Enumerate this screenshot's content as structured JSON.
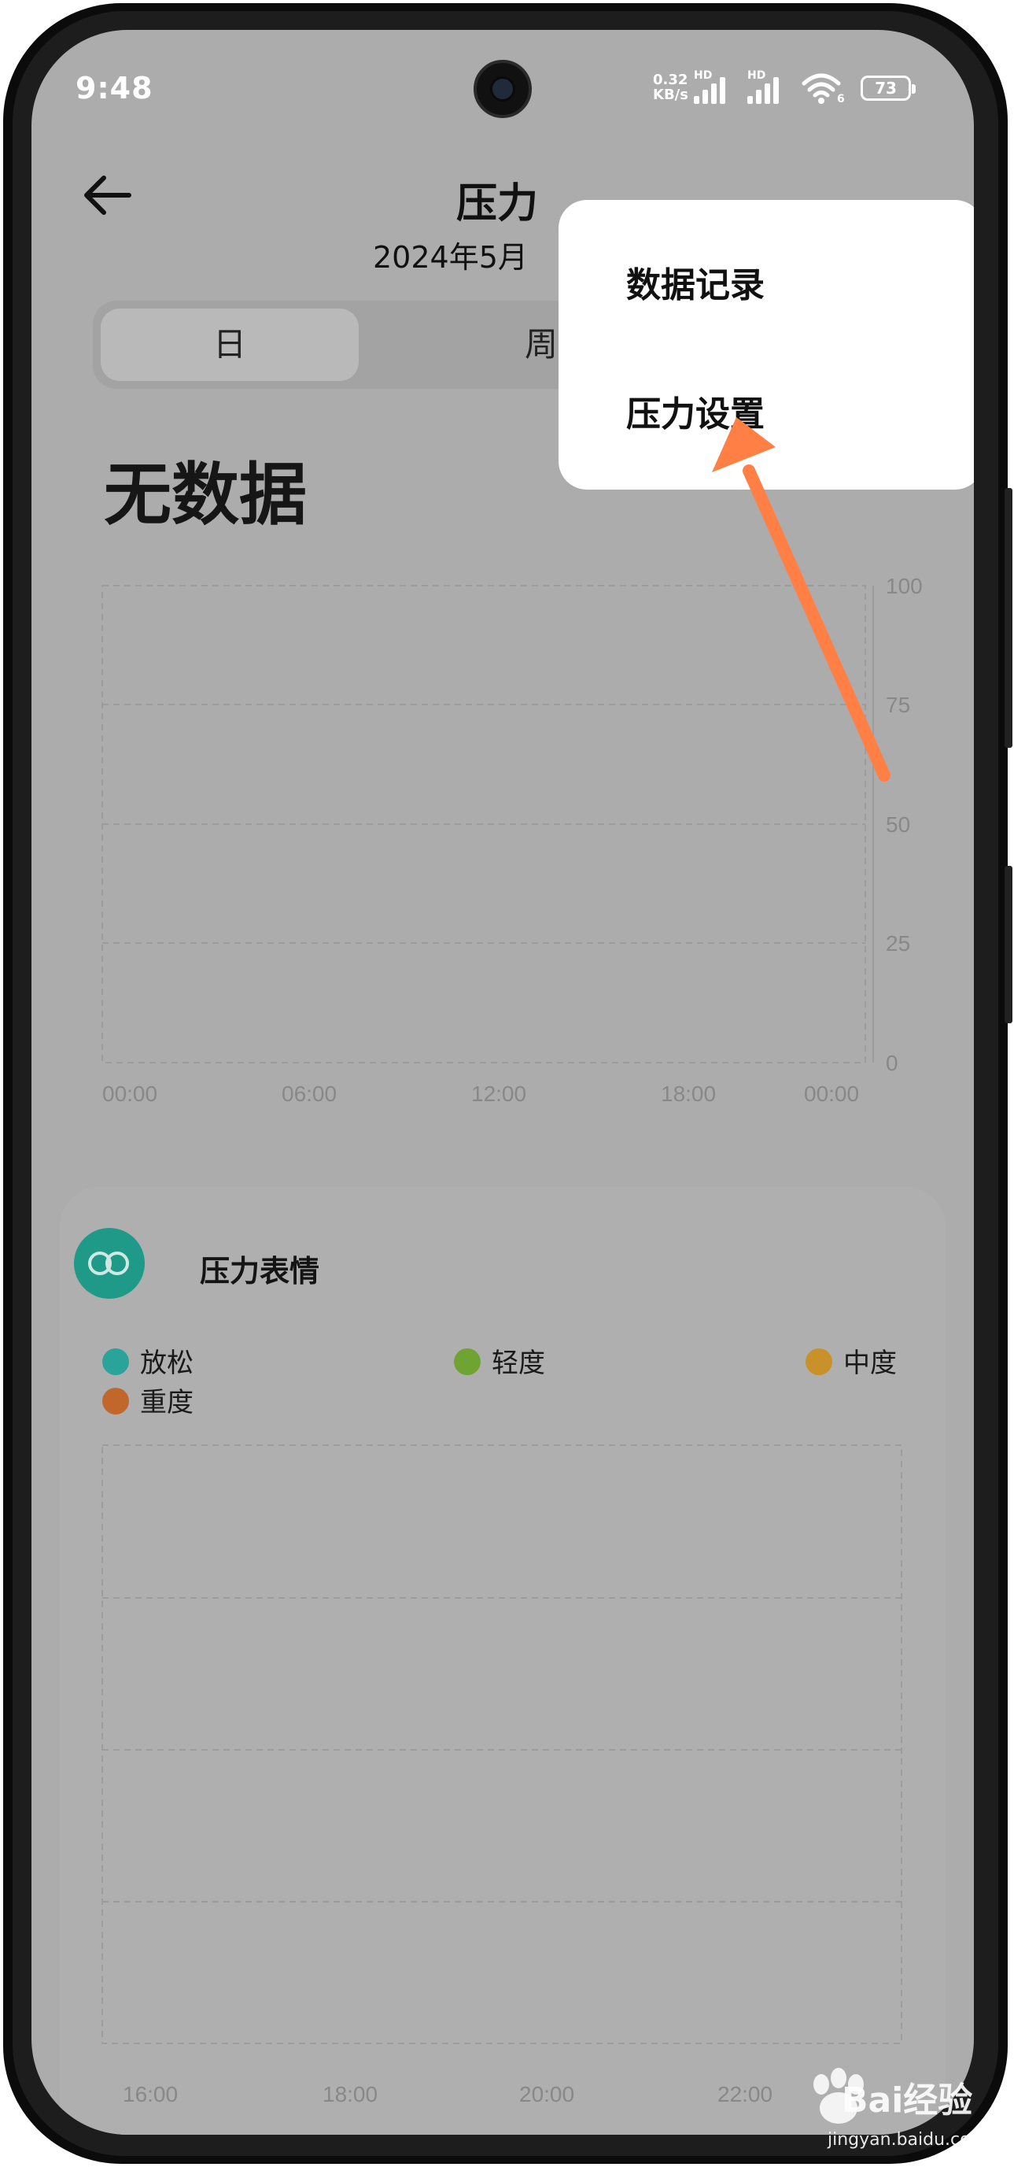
{
  "status_bar": {
    "time": "9:48",
    "net_speed_value": "0.32",
    "net_speed_unit": "KB/s",
    "signal1_label": "HD",
    "signal2_label": "HD",
    "wifi_badge": "6",
    "battery": "73"
  },
  "header": {
    "title": "压力",
    "date": "2024年5月"
  },
  "tabs": {
    "day": "日",
    "week": "周"
  },
  "summary": "无数据",
  "stress_chart": {
    "y_ticks": [
      "100",
      "75",
      "50",
      "25",
      "0"
    ],
    "x_ticks": [
      "00:00",
      "06:00",
      "12:00",
      "18:00",
      "00:00"
    ]
  },
  "chart_data": [
    {
      "type": "bar",
      "title": "",
      "categories": [
        "00:00",
        "06:00",
        "12:00",
        "18:00",
        "00:00"
      ],
      "series": [],
      "ylim": [
        0,
        100
      ],
      "y_ticks": [
        100,
        75,
        50,
        25,
        0
      ],
      "grid": true
    },
    {
      "type": "bar",
      "title": "压力表情",
      "categories": [
        "16:00",
        "18:00",
        "20:00",
        "22:00"
      ],
      "series": [],
      "legend": [
        "放松",
        "轻度",
        "中度",
        "重度"
      ],
      "grid": true
    }
  ],
  "emotion_card": {
    "title": "压力表情",
    "legend": [
      {
        "label": "放松",
        "color": "#2aa39a"
      },
      {
        "label": "轻度",
        "color": "#6fa332"
      },
      {
        "label": "中度",
        "color": "#c8912a"
      },
      {
        "label": "重度",
        "color": "#c2672c"
      }
    ],
    "x_ticks": [
      "16:00",
      "18:00",
      "20:00",
      "22:00"
    ]
  },
  "popup_menu": {
    "items": [
      "数据记录",
      "压力设置"
    ]
  },
  "annotation": {
    "arrow_color": "#ff7f45"
  },
  "watermark": {
    "brand": "Bai经验",
    "site": "jingyan.baidu.com"
  }
}
